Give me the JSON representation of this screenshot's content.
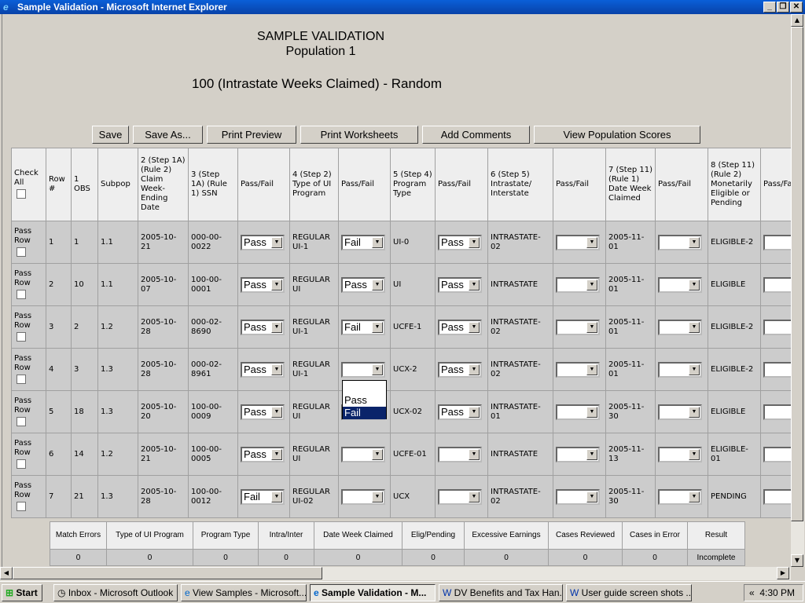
{
  "window": {
    "title": "Sample Validation - Microsoft Internet Explorer"
  },
  "page": {
    "title1": "SAMPLE VALIDATION",
    "title2": "Population 1",
    "subtitle": "100 (Intrastate Weeks Claimed) - Random"
  },
  "toolbar": [
    "Save",
    "Save As...",
    "Print Preview",
    "Print Worksheets",
    "Add Comments",
    "View Population Scores"
  ],
  "headers": [
    "Check All",
    "Row #",
    "1 OBS",
    "Subpop",
    "2 (Step 1A) (Rule 2) Claim Week-Ending Date",
    "3 (Step 1A) (Rule 1) SSN",
    "Pass/Fail",
    "4 (Step 2) Type of UI Program",
    "Pass/Fail",
    "5 (Step 4) Program Type",
    "Pass/Fail",
    "6 (Step 5) Intrastate/ Interstate",
    "Pass/Fail",
    "7 (Step 11) (Rule 1) Date Week Claimed",
    "Pass/Fail",
    "8 (Step 11) (Rule 2) Monetarily Eligible or Pending",
    "Pass/Fail"
  ],
  "row_check_label": "Pass Row",
  "rows": [
    [
      "1",
      "1",
      "1.1",
      "2005-10-21",
      "000-00-0022",
      "Pass",
      "REGULAR UI-1",
      "Fail",
      "UI-0",
      "Pass",
      "INTRASTATE-02",
      "",
      "2005-11-01",
      "",
      "ELIGIBLE-2",
      ""
    ],
    [
      "2",
      "10",
      "1.1",
      "2005-10-07",
      "100-00-0001",
      "Pass",
      "REGULAR UI",
      "Pass",
      "UI",
      "Pass",
      "INTRASTATE",
      "",
      "2005-11-01",
      "",
      "ELIGIBLE",
      ""
    ],
    [
      "3",
      "2",
      "1.2",
      "2005-10-28",
      "000-02-8690",
      "Pass",
      "REGULAR UI-1",
      "Fail",
      "UCFE-1",
      "Pass",
      "INTRASTATE-02",
      "",
      "2005-11-01",
      "",
      "ELIGIBLE-2",
      ""
    ],
    [
      "4",
      "3",
      "1.3",
      "2005-10-28",
      "000-02-8961",
      "Pass",
      "REGULAR UI-1",
      "",
      "UCX-2",
      "Pass",
      "INTRASTATE-02",
      "",
      "2005-11-01",
      "",
      "ELIGIBLE-2",
      ""
    ],
    [
      "5",
      "18",
      "1.3",
      "2005-10-20",
      "100-00-0009",
      "Pass",
      "REGULAR UI",
      "",
      "UCX-02",
      "Pass",
      "INTRASTATE-01",
      "",
      "2005-11-30",
      "",
      "ELIGIBLE",
      ""
    ],
    [
      "6",
      "14",
      "1.2",
      "2005-10-21",
      "100-00-0005",
      "Pass",
      "REGULAR UI",
      "",
      "UCFE-01",
      "",
      "INTRASTATE",
      "",
      "2005-11-13",
      "",
      "ELIGIBLE-01",
      ""
    ],
    [
      "7",
      "21",
      "1.3",
      "2005-10-28",
      "100-00-0012",
      "Fail",
      "REGULAR UI-02",
      "",
      "UCX",
      "",
      "INTRASTATE-02",
      "",
      "2005-11-30",
      "",
      "PENDING",
      ""
    ]
  ],
  "dropdown_open": {
    "options": [
      "Pass",
      "Fail"
    ],
    "highlighted": "Fail"
  },
  "summary": {
    "headers": [
      "Match Errors",
      "Type of UI Program",
      "Program Type",
      "Intra/Inter",
      "Date Week Claimed",
      "Elig/Pending",
      "Excessive Earnings",
      "Cases Reviewed",
      "Cases in Error",
      "Result"
    ],
    "values": [
      "0",
      "0",
      "0",
      "0",
      "0",
      "0",
      "0",
      "0",
      "0",
      "Incomplete"
    ]
  },
  "taskbar": {
    "start": "Start",
    "tasks": [
      "Inbox - Microsoft Outlook",
      "View Samples - Microsoft...",
      "Sample Validation - M...",
      "DV Benefits and Tax Han...",
      "User guide screen shots ..."
    ],
    "clock": "4:30 PM"
  }
}
